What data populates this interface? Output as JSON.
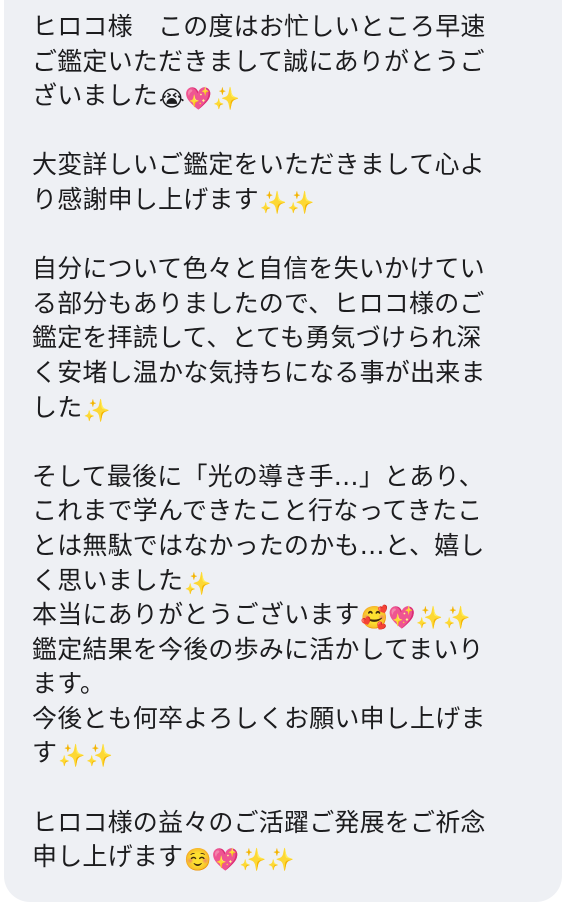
{
  "message": {
    "p1": {
      "l1": "ヒロコ様　この度はお忙しいところ早速",
      "l2": "ご鑑定いただきまして誠にありがとうご",
      "l3": "ざいました",
      "emoji": "😭💖✨"
    },
    "p2": {
      "l1": "大変詳しいご鑑定をいただきまして心よ",
      "l2": "り感謝申し上げます",
      "emoji": "✨✨"
    },
    "p3": {
      "l1": "自分について色々と自信を失いかけてい",
      "l2": "る部分もありましたので、ヒロコ様のご",
      "l3": "鑑定を拝読して、とても勇気づけられ深",
      "l4": "く安堵し温かな気持ちになる事が出来ま",
      "l5": "した",
      "emoji": "✨"
    },
    "p4": {
      "l1": "そして最後に「光の導き手…」とあり、",
      "l2": "これまで学んできたこと行なってきたこ",
      "l3": "とは無駄ではなかったのかも…と、嬉し",
      "l4": "く思いました",
      "l4_emoji": "✨",
      "l5": "本当にありがとうございます",
      "l5_emoji": "🥰💖✨✨",
      "l6": "鑑定結果を今後の歩みに活かしてまいり",
      "l7": "ます。",
      "l8": "今後とも何卒よろしくお願い申し上げま",
      "l9": "す",
      "l9_emoji": "✨✨"
    },
    "p5": {
      "l1": "ヒロコ様の益々のご活躍ご発展をご祈念",
      "l2": "申し上げます",
      "emoji": "☺️💖✨✨"
    }
  },
  "colors": {
    "bubble_background": "#eef0f4",
    "text": "#1c1c1e"
  }
}
